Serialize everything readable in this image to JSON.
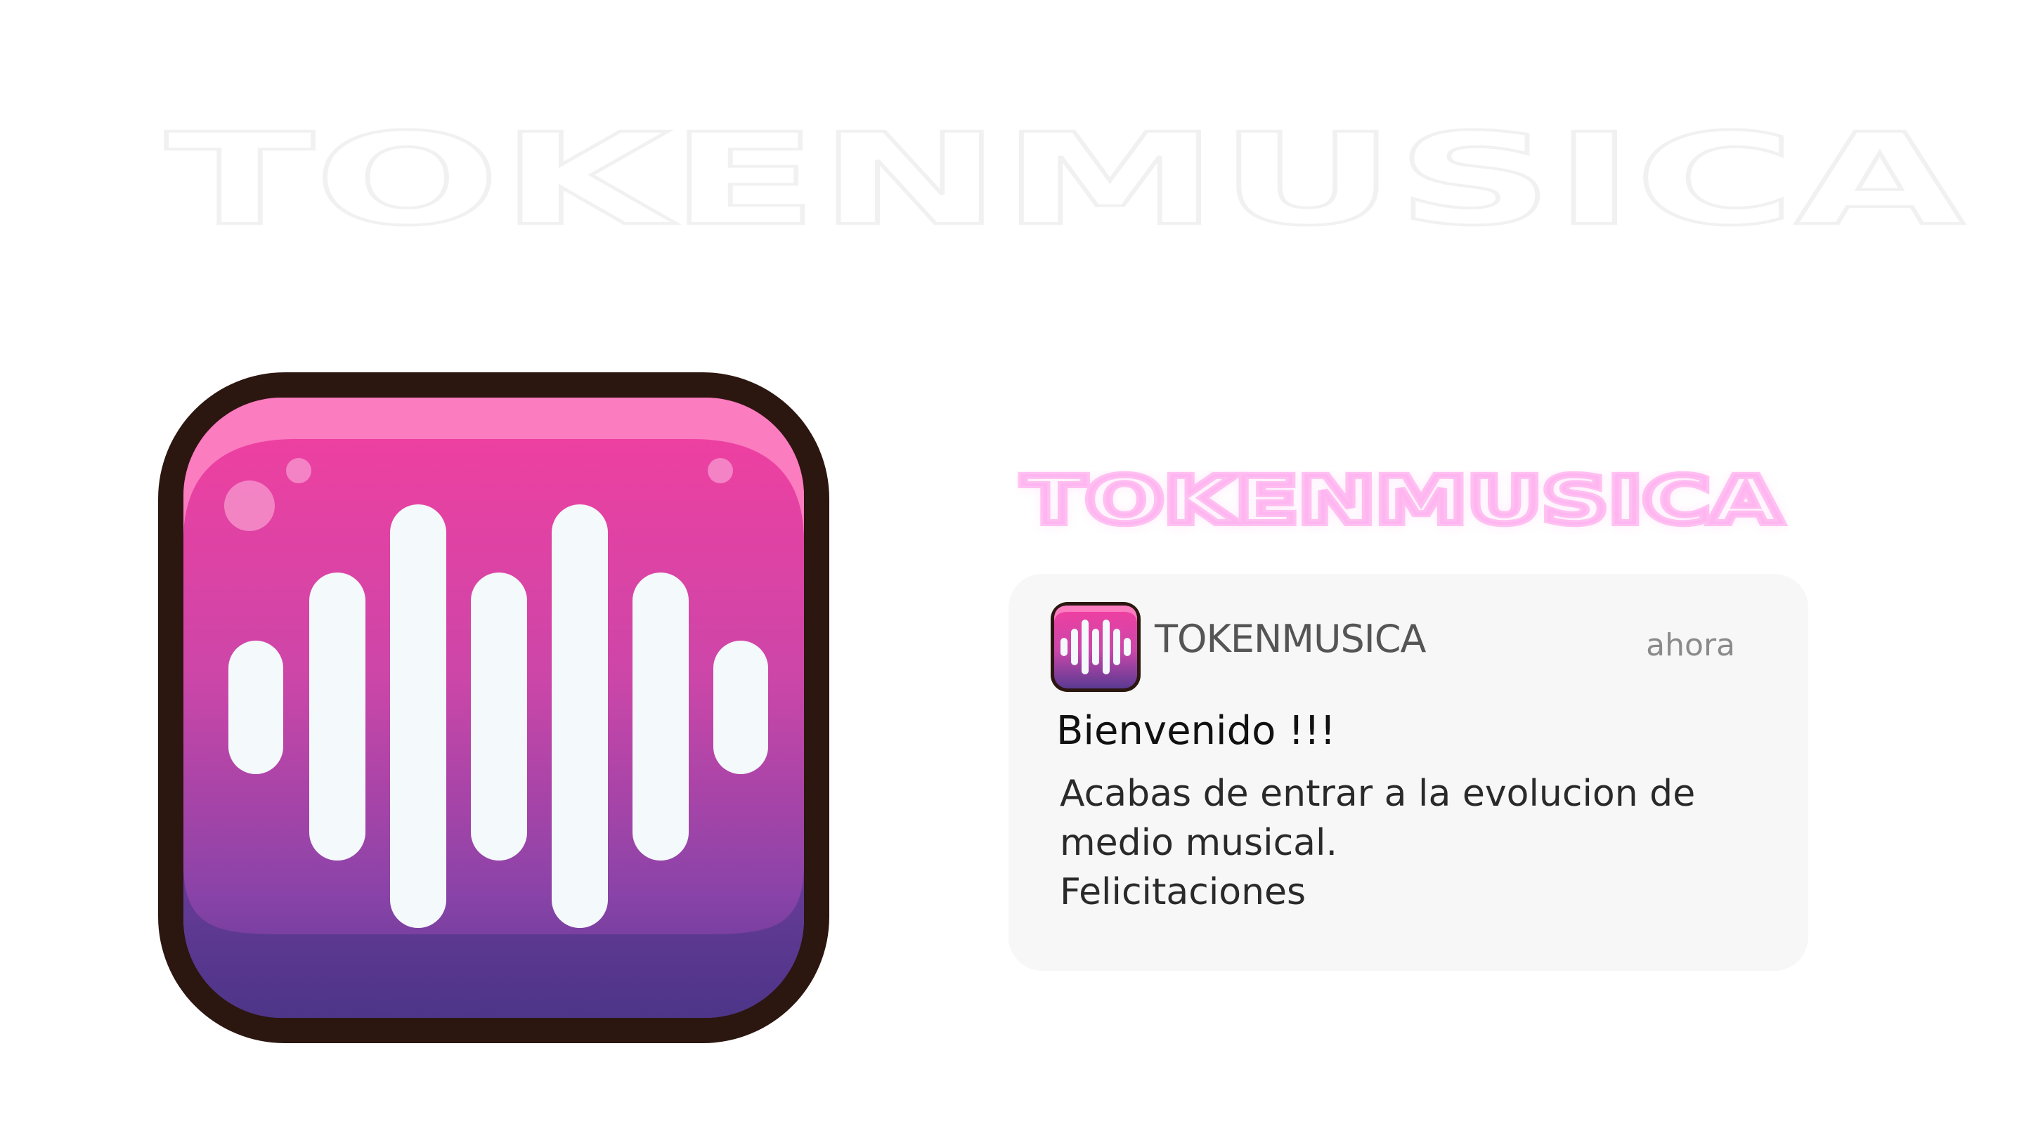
{
  "watermark": {
    "text": "TOKENMUSICA"
  },
  "app_icon": {
    "icon_name": "soundwave-app-icon",
    "colors": {
      "outline": "#2c1610",
      "top": "#f26aae",
      "middle": "#d53d9c",
      "bottom": "#5a3a92",
      "bars": "#f4f9fb"
    }
  },
  "brand_title": {
    "text": "TOKENMUSICA",
    "glow_color": "#ff4fd8"
  },
  "notification": {
    "app_name": "TOKENMUSICA",
    "time": "ahora",
    "title": "Bienvenido !!!",
    "body_lines": [
      "Acabas de entrar a la evolucion de",
      "medio musical.",
      "Felicitaciones"
    ]
  }
}
